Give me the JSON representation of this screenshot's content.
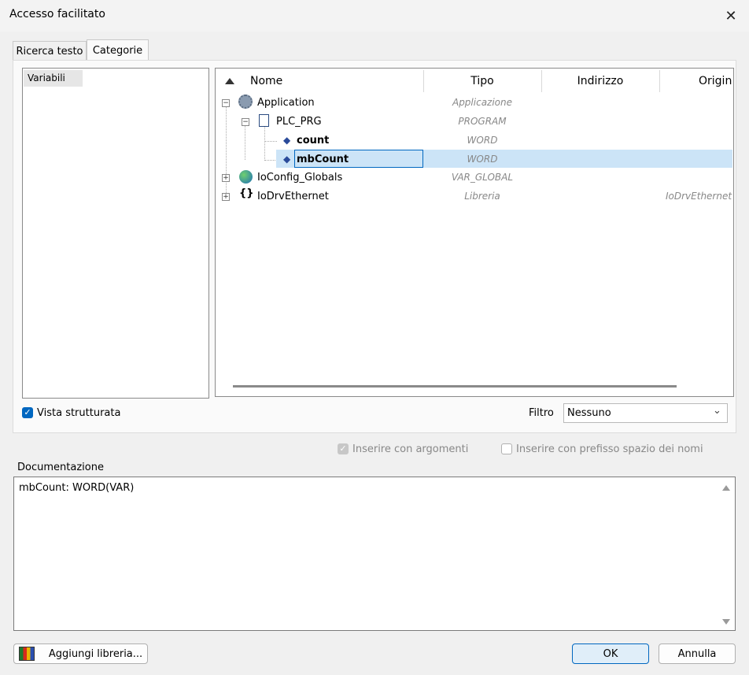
{
  "window": {
    "title": "Accesso facilitato"
  },
  "tabs": [
    {
      "label": "Ricerca testo"
    },
    {
      "label": "Categorie"
    }
  ],
  "categories": [
    {
      "label": "Variabili"
    }
  ],
  "tree": {
    "columns": [
      "Nome",
      "Tipo",
      "Indirizzo",
      "Origin"
    ],
    "rows": [
      {
        "name": "Application",
        "type": "Applicazione",
        "origin": ""
      },
      {
        "name": "PLC_PRG",
        "type": "PROGRAM",
        "origin": ""
      },
      {
        "name": "count",
        "type": "WORD",
        "origin": ""
      },
      {
        "name": "mbCount",
        "type": "WORD",
        "origin": ""
      },
      {
        "name": "IoConfig_Globals",
        "type": "VAR_GLOBAL",
        "origin": ""
      },
      {
        "name": "IoDrvEthernet",
        "type": "Libreria",
        "origin": "IoDrvEthernet"
      }
    ]
  },
  "options": {
    "structured_view": "Vista strutturata",
    "filter_label": "Filtro",
    "filter_value": "Nessuno",
    "insert_args": "Inserire con argomenti",
    "insert_ns": "Inserire con prefisso spazio dei nomi"
  },
  "documentation": {
    "label": "Documentazione",
    "text": "mbCount: WORD(VAR)"
  },
  "buttons": {
    "add_library": "Aggiungi libreria...",
    "ok": "OK",
    "cancel": "Annulla"
  },
  "colors": {
    "accent": "#0067c0",
    "selection": "#cce4f7"
  }
}
